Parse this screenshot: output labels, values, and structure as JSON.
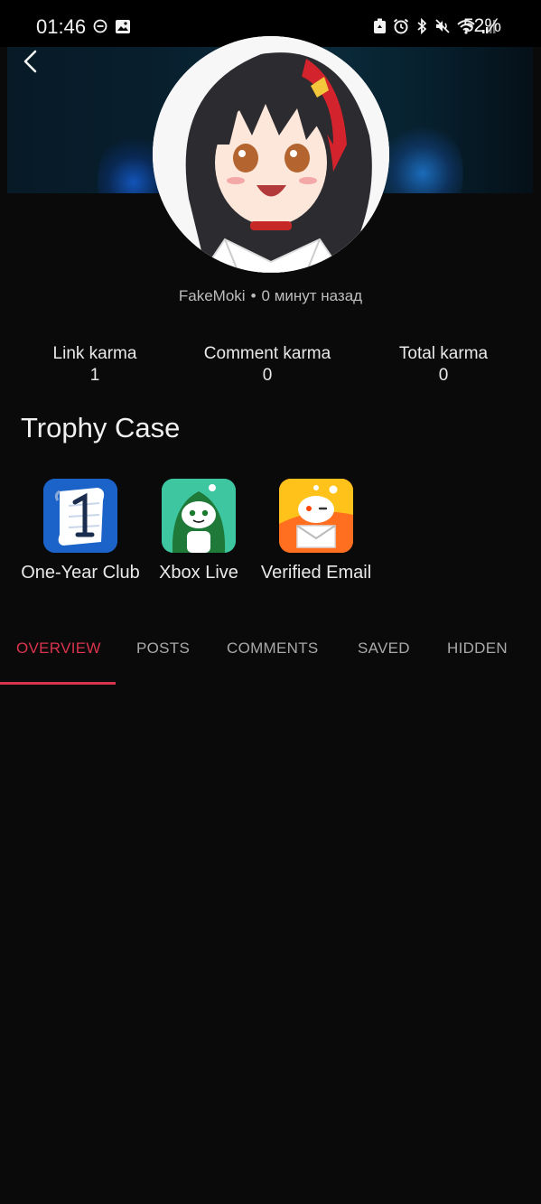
{
  "status_bar": {
    "time": "01:46",
    "battery": "52%",
    "left_icons": [
      "do-not-disturb-icon",
      "gallery-icon"
    ],
    "right_icons": [
      "recycle-icon",
      "alarm-icon",
      "bluetooth-icon",
      "mute-icon",
      "wifi-icon",
      "signal-icon"
    ]
  },
  "header": {
    "back_icon": "chevron-left-icon"
  },
  "profile": {
    "username": "FakeMoki",
    "separator": "•",
    "joined": "0 минут назад"
  },
  "karma": [
    {
      "label": "Link karma",
      "value": "1"
    },
    {
      "label": "Comment karma",
      "value": "0"
    },
    {
      "label": "Total karma",
      "value": "0"
    }
  ],
  "trophy_case": {
    "title": "Trophy Case",
    "trophies": [
      {
        "label": "One-Year Club",
        "icon": "one-year-club-icon"
      },
      {
        "label": "Xbox Live",
        "icon": "xbox-live-icon"
      },
      {
        "label": "Verified Email",
        "icon": "verified-email-icon"
      }
    ]
  },
  "tabs": [
    {
      "label": "OVERVIEW",
      "active": true
    },
    {
      "label": "POSTS",
      "active": false
    },
    {
      "label": "COMMENTS",
      "active": false
    },
    {
      "label": "SAVED",
      "active": false
    },
    {
      "label": "HIDDEN",
      "active": false
    }
  ],
  "colors": {
    "background": "#0a0a0a",
    "accent": "#d9344d",
    "tab_inactive": "#a9a9a9"
  }
}
